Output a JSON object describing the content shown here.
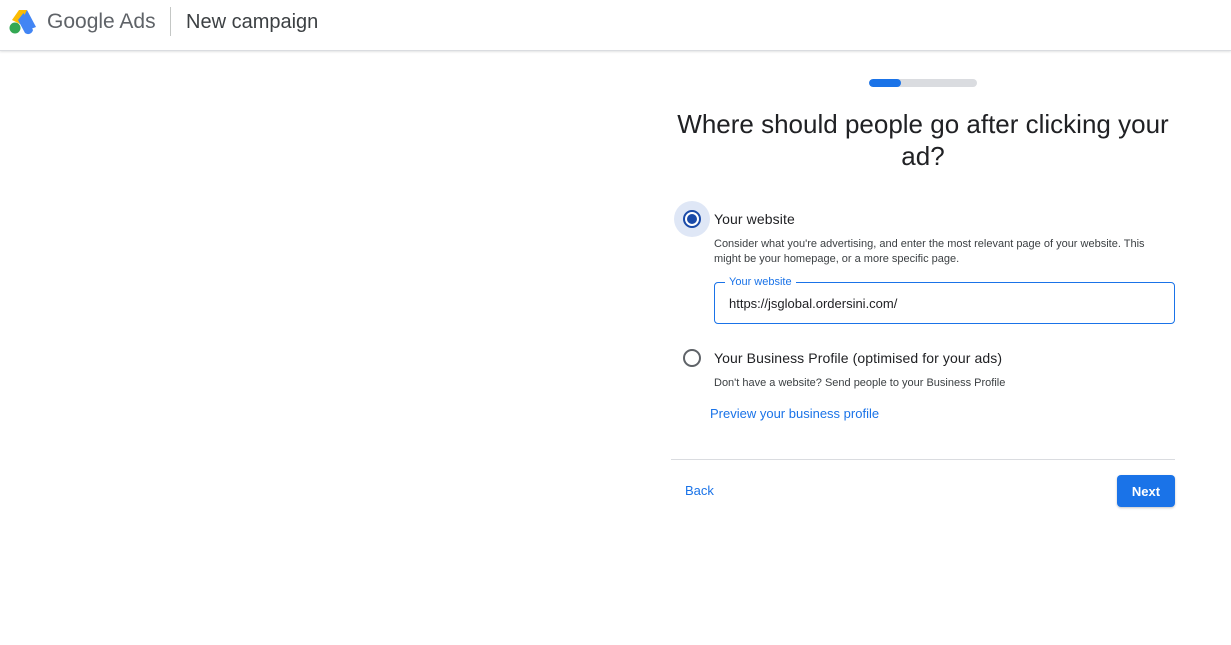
{
  "header": {
    "brand_word_1": "Google",
    "brand_word_2": "Ads",
    "page_title": "New campaign",
    "logo_icon": "google-ads-logo-icon"
  },
  "progress": {
    "fraction": 0.3
  },
  "question": "Where should people go after clicking your ad?",
  "options": [
    {
      "title": "Your website",
      "description": "Consider what you're advertising, and enter the most relevant page of your website. This might be your homepage, or a more specific page.",
      "selected": true
    },
    {
      "title": "Your Business Profile (optimised for your ads)",
      "description": "Don't have a website? Send people to your Business Profile",
      "selected": false,
      "link": "Preview your business profile"
    }
  ],
  "website_field": {
    "label": "Your website",
    "value": "https://jsglobal.ordersini.com/"
  },
  "footer": {
    "back_label": "Back",
    "next_label": "Next"
  },
  "colors": {
    "accent": "#1a73e8",
    "radio_selected": "#1a4aa8"
  }
}
